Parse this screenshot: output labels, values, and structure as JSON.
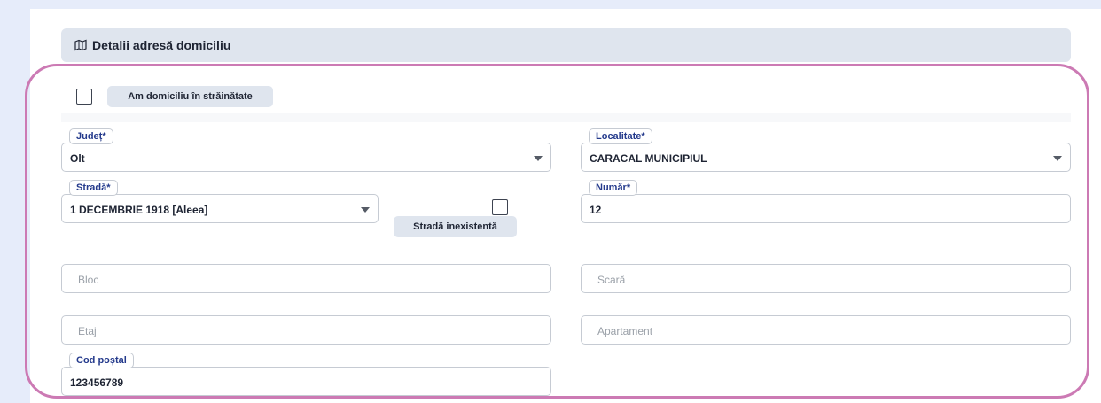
{
  "section": {
    "title": "Detalii adresă domiciliu",
    "icon": "map-icon"
  },
  "abroad": {
    "label": "Am domiciliu în străinătate",
    "checked": false
  },
  "fields": {
    "judet": {
      "label": "Județ*",
      "value": "Olt"
    },
    "localitate": {
      "label": "Localitate*",
      "value": "CARACAL MUNICIPIUL"
    },
    "strada": {
      "label": "Stradă*",
      "value": "1 DECEMBRIE 1918 [Aleea]"
    },
    "strada_inexistenta": {
      "label": "Stradă inexistentă",
      "checked": false
    },
    "numar": {
      "label": "Număr*",
      "value": "12"
    },
    "bloc": {
      "placeholder": "Bloc"
    },
    "scara": {
      "placeholder": "Scară"
    },
    "etaj": {
      "placeholder": "Etaj"
    },
    "apartament": {
      "placeholder": "Apartament"
    },
    "cod_postal": {
      "label": "Cod poștal",
      "value": "123456789"
    }
  },
  "colors": {
    "background": "#e6ecfa",
    "header": "#dfe5ee",
    "label_text": "#243a8c",
    "highlight": "#cc7ab4"
  }
}
